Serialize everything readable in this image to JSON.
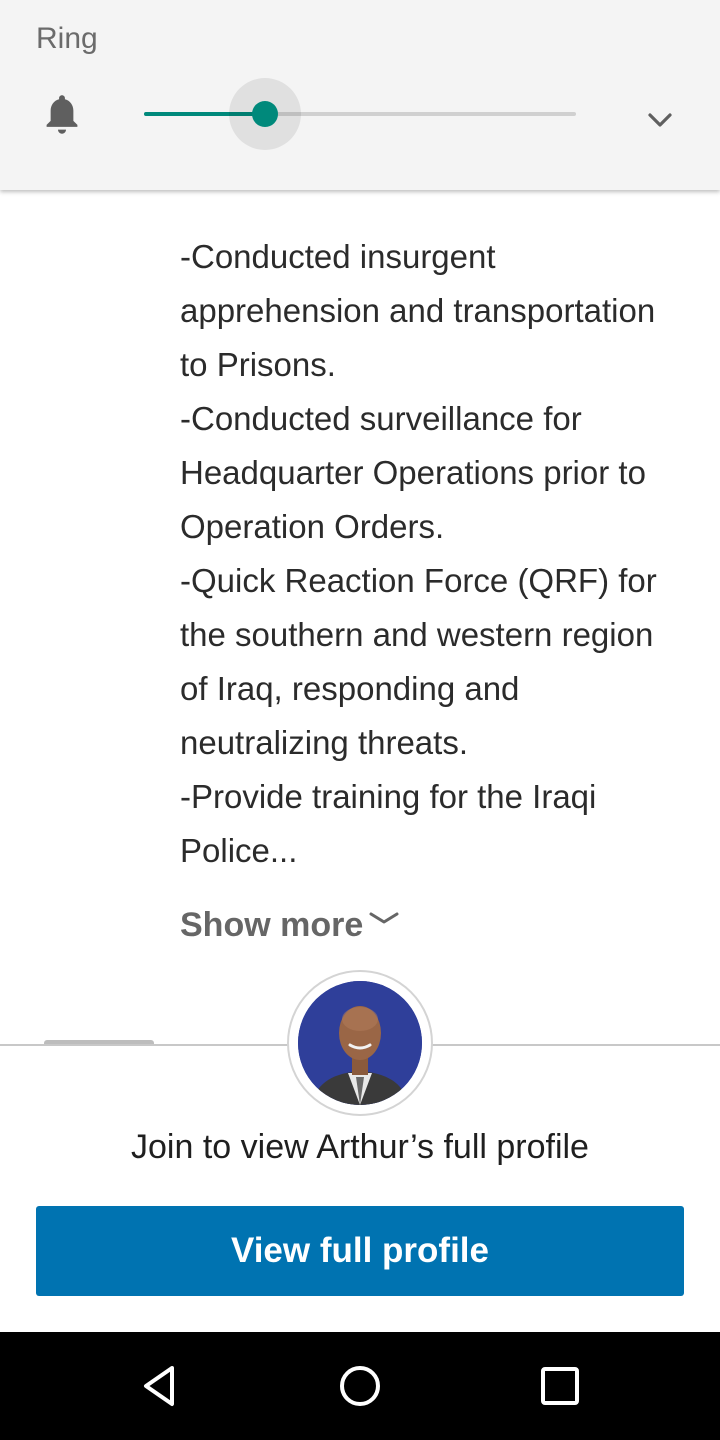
{
  "volume_panel": {
    "label": "Ring",
    "level": 0.28,
    "accent_color": "#00897b",
    "icons": {
      "ring": "bell-icon",
      "expand": "chevron-down-icon"
    }
  },
  "content": {
    "paragraphs": [
      "-Conducted insurgent apprehension and transportation to Prisons.",
      "-Conducted surveillance for Headquarter Operations prior to Operation Orders.",
      "-Quick Reaction Force (QRF) for the southern and western region of Iraq, responding and neutralizing threats.",
      "-Provide training for the Iraqi Police..."
    ],
    "show_more_label": "Show more"
  },
  "bottom_sheet": {
    "title": "Join to view Arthur’s full profile",
    "button_label": "View full profile",
    "button_color": "#0073b1"
  },
  "nav_bar": {
    "icons": [
      "back-icon",
      "home-icon",
      "recents-icon"
    ]
  }
}
